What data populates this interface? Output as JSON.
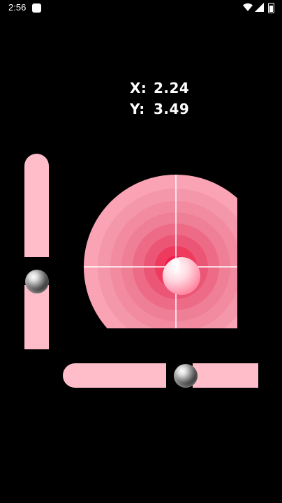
{
  "status_bar": {
    "time": "2:56"
  },
  "readout": {
    "x_label": "X:",
    "x_value": "2.24",
    "y_label": "Y:",
    "y_value": "3.49"
  },
  "colors": {
    "tube": "#ffbdca",
    "ring_outer": "#f9a3b5",
    "ring_center": "#f01a4a",
    "crosshair": "#ffffff"
  },
  "icons": [
    "notification-icon",
    "wifi-icon",
    "signal-icon",
    "battery-icon"
  ]
}
